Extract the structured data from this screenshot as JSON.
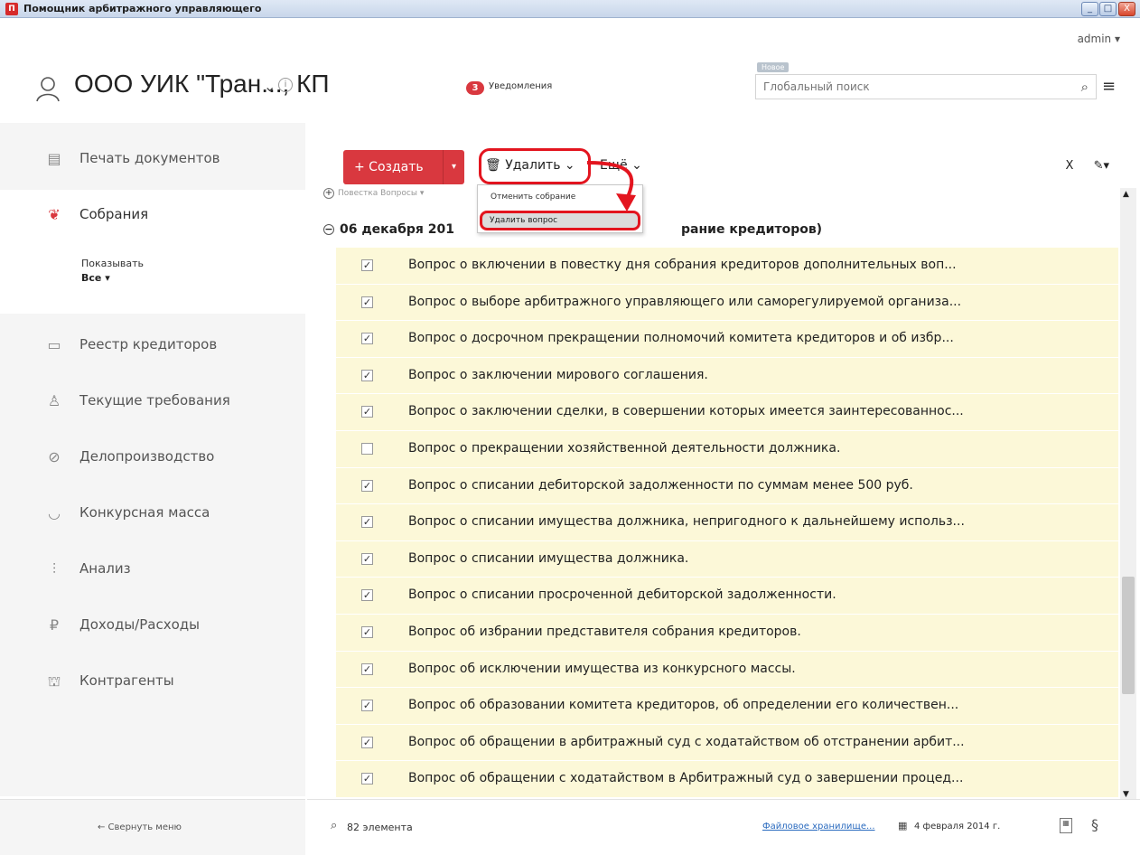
{
  "window": {
    "title": "Помощник арбитражного управляющего",
    "minimize": "_",
    "maximize": "□",
    "close": "X"
  },
  "header": {
    "user": "admin ▾",
    "org_name": "ООО УИК \"Тран..., КП",
    "org_chevron": "⌄",
    "info": "i",
    "notifications_count": "3",
    "notifications_label": "Уведомления",
    "search_tag": "Новое",
    "search_placeholder": "Глобальный поиск"
  },
  "sidebar": {
    "items": [
      {
        "label": "Печать документов",
        "icon": "document-icon"
      },
      {
        "label": "Собрания",
        "icon": "handshake-icon"
      },
      {
        "label": "Реестр кредиторов",
        "icon": "id-card-icon"
      },
      {
        "label": "Текущие требования",
        "icon": "badge-icon"
      },
      {
        "label": "Делопроизводство",
        "icon": "paperclip-icon"
      },
      {
        "label": "Конкурсная масса",
        "icon": "basket-icon"
      },
      {
        "label": "Анализ",
        "icon": "bar-chart-icon"
      },
      {
        "label": "Доходы/Расходы",
        "icon": "ruble-icon"
      },
      {
        "label": "Контрагенты",
        "icon": "bank-icon"
      }
    ],
    "show_caption": "Показывать",
    "show_value": "Все ▾",
    "collapse": "← Свернуть меню"
  },
  "toolbar": {
    "create": "+ Создать",
    "create_split": "▾",
    "delete": "🗑 Удалить ⌄",
    "more": "Ещё ⌄",
    "tool_x": "X",
    "tool_edit": "✎▾"
  },
  "breadcrumb": "Повестка Вопросы ▾",
  "delete_menu": {
    "option1": "Отменить собрание",
    "option2": "Удалить вопрос"
  },
  "group": {
    "start": "06 декабря 201",
    "end": "рание кредиторов)"
  },
  "rows": [
    {
      "checked": true,
      "text": "Вопрос о включении в повестку дня собрания кредиторов дополнительных воп..."
    },
    {
      "checked": true,
      "text": "Вопрос о выборе арбитражного управляющего или саморегулируемой организа..."
    },
    {
      "checked": true,
      "text": "Вопрос о досрочном прекращении полномочий комитета кредиторов и об избр..."
    },
    {
      "checked": true,
      "text": "Вопрос о заключении мирового соглашения."
    },
    {
      "checked": true,
      "text": "Вопрос о заключении сделки, в совершении которых имеется заинтересованнос..."
    },
    {
      "checked": false,
      "text": "Вопрос о прекращении хозяйственной деятельности должника."
    },
    {
      "checked": true,
      "text": "Вопрос о списании дебиторской задолженности по суммам менее 500 руб."
    },
    {
      "checked": true,
      "text": "Вопрос о списании имущества должника, непригодного к дальнейшему использ..."
    },
    {
      "checked": true,
      "text": "Вопрос о списании имущества должника."
    },
    {
      "checked": true,
      "text": "Вопрос о списании просроченной дебиторской задолженности."
    },
    {
      "checked": true,
      "text": "Вопрос об избрании представителя собрания кредиторов."
    },
    {
      "checked": true,
      "text": "Вопрос об исключении имущества из конкурсного массы."
    },
    {
      "checked": true,
      "text": "Вопрос об образовании комитета кредиторов, об определении его количествен..."
    },
    {
      "checked": true,
      "text": "Вопрос об обращении в арбитражный суд с ходатайством об отстранении арбит..."
    },
    {
      "checked": true,
      "text": "Вопрос об обращении с ходатайством в Арбитражный суд о завершении процед..."
    }
  ],
  "footer": {
    "count": "82 элемента",
    "storage": "Файловое хранилище...",
    "date": "4 февраля 2014 г."
  },
  "colors": {
    "accent": "#d9383f",
    "highlight_outline": "#e3151f",
    "row_background": "#fcf8d8",
    "link": "#2b6bbf"
  }
}
